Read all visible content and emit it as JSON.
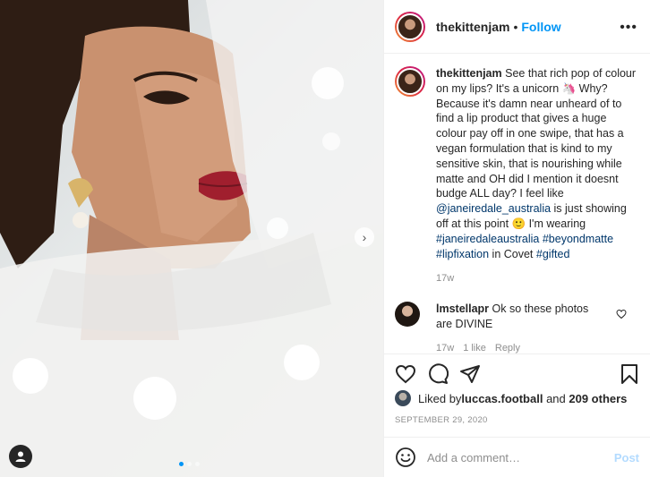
{
  "post": {
    "username": "thekittenjam",
    "header_separator": "•",
    "follow_label": "Follow",
    "more_label": "•••",
    "caption": {
      "username": "thekittenjam",
      "text_1": " See that rich pop of colour on my lips? It's a unicorn 🦄 Why? Because it's damn near unheard of to find a lip product that gives a huge colour pay off in one swipe, that has a vegan formulation that is kind to my sensitive skin, that is nourishing while matte and OH did I mention it doesnt budge ALL day? I feel like ",
      "mention": "@janeiredale_australia",
      "text_2": " is just showing off at this point 🙂 I'm wearing ",
      "tag1": "#janeiredaleaustralia",
      "tag2": "#beyondmatte",
      "tag3": "#lipfixation",
      "text_3": " in Covet ",
      "tag4": "#gifted",
      "age": "17w"
    },
    "comment": {
      "username": "lmstellapr",
      "text": " Ok so these photos are DIVINE",
      "age": "17w",
      "likes": "1 like",
      "reply_label": "Reply"
    },
    "likes": {
      "prefix": "Liked by ",
      "user": "luccas.football",
      "middle": " and ",
      "count": "209 others"
    },
    "date": "SEPTEMBER 29, 2020",
    "add_comment_placeholder": "Add a comment…",
    "post_label": "Post",
    "carousel": {
      "count": 3,
      "active_index": 0
    }
  },
  "colors": {
    "accent": "#0095f6",
    "link": "#00376b",
    "muted": "#8e8e8e"
  }
}
